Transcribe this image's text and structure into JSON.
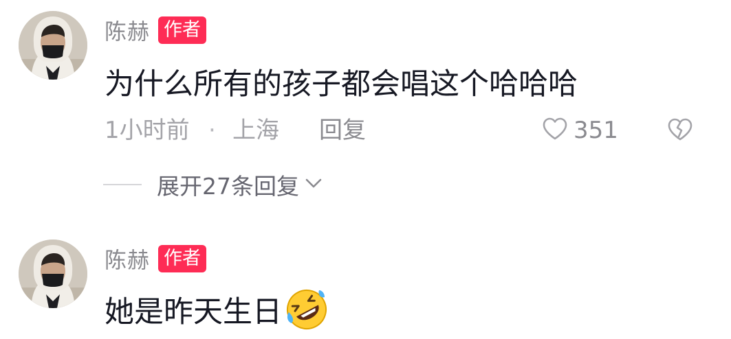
{
  "comments": [
    {
      "author": "陈赫",
      "badge": "作者",
      "text": "为什么所有的孩子都会唱这个哈哈哈",
      "time": "1小时前",
      "separator": "·",
      "location": "上海",
      "reply_label": "回复",
      "like_count": "351",
      "expand_label": "展开27条回复"
    },
    {
      "author": "陈赫",
      "badge": "作者",
      "text": "她是昨天生日",
      "emoji": "rolling-on-floor-laughing-icon"
    }
  ],
  "colors": {
    "badge_bg": "#fe2c55",
    "text_primary": "#161823",
    "text_secondary": "#8a8a8f"
  }
}
